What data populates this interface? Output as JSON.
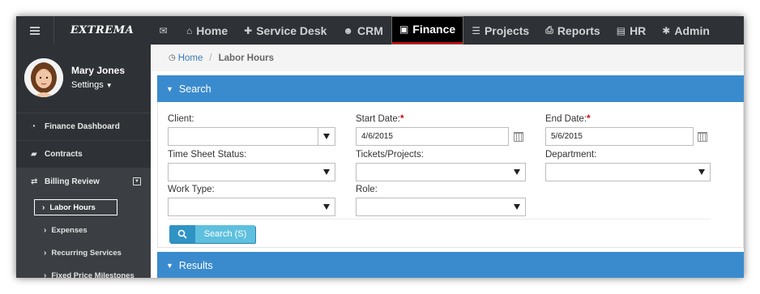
{
  "brand": {
    "logo_text": "EXTREMA"
  },
  "nav": {
    "items": [
      {
        "id": "mail",
        "label": "",
        "icon": "envelope-icon",
        "glyph": "✉"
      },
      {
        "id": "home",
        "label": "Home",
        "icon": "home-icon",
        "glyph": "⌂"
      },
      {
        "id": "service-desk",
        "label": "Service Desk",
        "icon": "puzzle-icon",
        "glyph": "✚"
      },
      {
        "id": "crm",
        "label": "CRM",
        "icon": "users-icon",
        "glyph": "☻"
      },
      {
        "id": "finance",
        "label": "Finance",
        "icon": "money-icon",
        "glyph": "▣",
        "active": true
      },
      {
        "id": "projects",
        "label": "Projects",
        "icon": "list-icon",
        "glyph": "☰"
      },
      {
        "id": "reports",
        "label": "Reports",
        "icon": "print-icon",
        "glyph": "⎙"
      },
      {
        "id": "hr",
        "label": "HR",
        "icon": "briefcase-icon",
        "glyph": "▤"
      },
      {
        "id": "admin",
        "label": "Admin",
        "icon": "gear-icon",
        "glyph": "✱"
      }
    ]
  },
  "user": {
    "name": "Mary Jones",
    "settings_label": "Settings"
  },
  "sidebar": {
    "items": [
      {
        "label": "Finance Dashboard",
        "icon": "dashboard-icon",
        "glyph": "◔"
      },
      {
        "label": "Contracts",
        "icon": "book-icon",
        "glyph": "▰"
      },
      {
        "label": "Billing Review",
        "icon": "retweet-icon",
        "glyph": "⇄",
        "expanded": true
      }
    ],
    "subitems": [
      {
        "label": "Labor Hours",
        "active": true
      },
      {
        "label": "Expenses"
      },
      {
        "label": "Recurring Services"
      },
      {
        "label": "Fixed Price Milestones"
      }
    ]
  },
  "breadcrumb": {
    "home": "Home",
    "current": "Labor Hours"
  },
  "search_panel": {
    "title": "Search",
    "fields": {
      "client": {
        "label": "Client:",
        "value": ""
      },
      "start_date": {
        "label": "Start Date:",
        "required_mark": "*",
        "value": "4/6/2015"
      },
      "end_date": {
        "label": "End Date:",
        "required_mark": "*",
        "value": "5/6/2015"
      },
      "time_sheet_status": {
        "label": "Time Sheet Status:",
        "value": ""
      },
      "tickets_projects": {
        "label": "Tickets/Projects:",
        "value": ""
      },
      "department": {
        "label": "Department:",
        "value": ""
      },
      "work_type": {
        "label": "Work Type:",
        "value": ""
      },
      "role": {
        "label": "Role:",
        "value": ""
      }
    },
    "search_button_label": "Search (S)"
  },
  "results_panel": {
    "title": "Results"
  },
  "colors": {
    "topbar_bg": "#2e3236",
    "active_tab_bg": "#000000",
    "active_tab_underline": "#d40000",
    "panel_header_bg": "#3a8bce",
    "button_light": "#5ec0de",
    "button_dark": "#2f93c4",
    "link": "#3a7ab8",
    "required": "#d00000"
  }
}
